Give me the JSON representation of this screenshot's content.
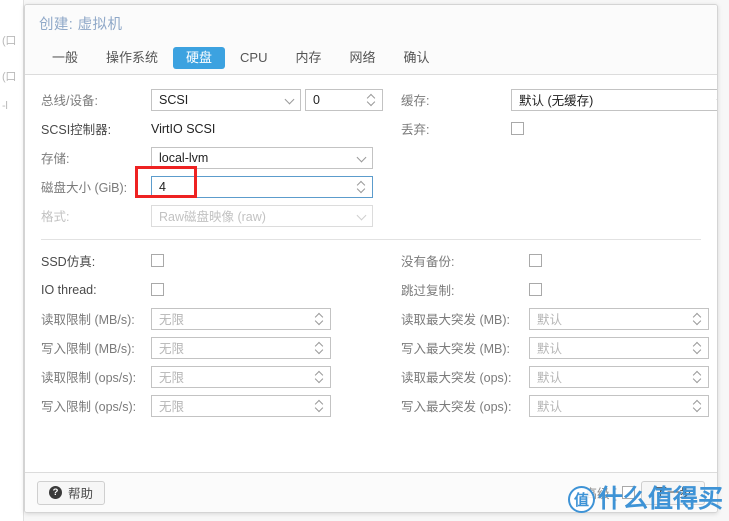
{
  "background": {
    "ghost_lines": [
      "(口",
      "(口",
      "-l"
    ]
  },
  "dialog": {
    "title": "创建: 虚拟机",
    "tabs": [
      {
        "label": "一般",
        "active": false
      },
      {
        "label": "操作系统",
        "active": false
      },
      {
        "label": "硬盘",
        "active": true
      },
      {
        "label": "CPU",
        "active": false
      },
      {
        "label": "内存",
        "active": false
      },
      {
        "label": "网络",
        "active": false
      },
      {
        "label": "确认",
        "active": false
      }
    ]
  },
  "form": {
    "bus_device": {
      "label": "总线/设备:",
      "bus_value": "SCSI",
      "device_value": "0"
    },
    "scsi_controller": {
      "label": "SCSI控制器:",
      "value": "VirtIO SCSI"
    },
    "storage": {
      "label": "存储:",
      "value": "local-lvm"
    },
    "disk_size": {
      "label": "磁盘大小 (GiB):",
      "value": "4"
    },
    "format": {
      "label": "格式:",
      "value": "Raw磁盘映像 (raw)"
    },
    "cache": {
      "label": "缓存:",
      "value": "默认 (无缓存)"
    },
    "discard": {
      "label": "丢弃:",
      "checked": false
    },
    "ssd_emulation": {
      "label": "SSD仿真:",
      "checked": false
    },
    "io_thread": {
      "label": "IO thread:",
      "checked": false
    },
    "no_backup": {
      "label": "没有备份:",
      "checked": false
    },
    "skip_replication": {
      "label": "跳过复制:",
      "checked": false
    },
    "left_limits": [
      {
        "label": "读取限制 (MB/s):",
        "value": "无限"
      },
      {
        "label": "写入限制 (MB/s):",
        "value": "无限"
      },
      {
        "label": "读取限制 (ops/s):",
        "value": "无限"
      },
      {
        "label": "写入限制 (ops/s):",
        "value": "无限"
      }
    ],
    "right_limits": [
      {
        "label": "读取最大突发 (MB):",
        "value": "默认"
      },
      {
        "label": "写入最大突发 (MB):",
        "value": "默认"
      },
      {
        "label": "读取最大突发 (ops):",
        "value": "默认"
      },
      {
        "label": "写入最大突发 (ops):",
        "value": "默认"
      }
    ]
  },
  "footer": {
    "help_label": "帮助",
    "help_icon": "question-mark-icon",
    "advanced_label": "高级 [",
    "advanced_checked": false,
    "next_label": "下一步"
  },
  "watermark": {
    "badge": "值",
    "text": "什么值得买",
    "color": "#3e93d6"
  },
  "colors": {
    "accent": "#3ca2e0",
    "title": "#8fa8c8",
    "annotation": "#ee2222",
    "label": "#7b7b7b",
    "disabled": "#c2c2c2"
  }
}
